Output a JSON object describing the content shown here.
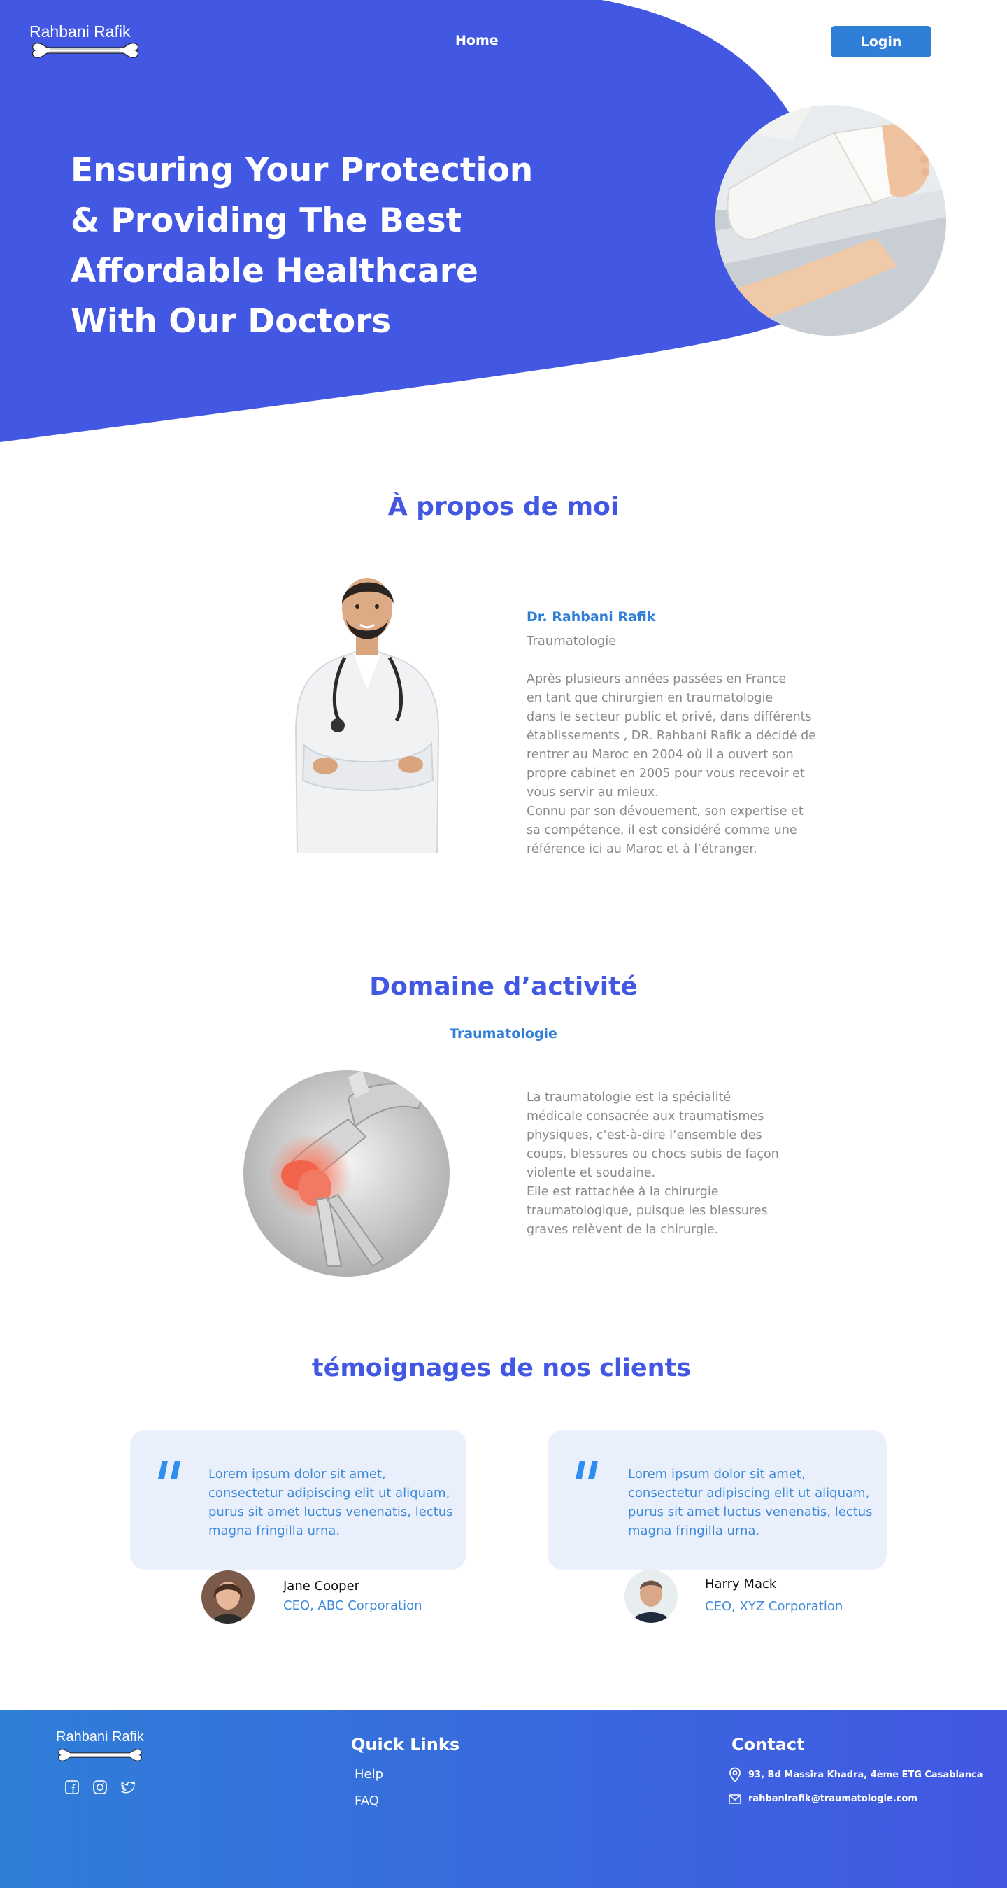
{
  "brand": {
    "name": "Rahbani Rafik"
  },
  "nav": {
    "home": "Home",
    "login": "Login"
  },
  "hero": {
    "title_lines": [
      "Ensuring Your Protection",
      "& Providing The Best",
      "Affordable Healthcare",
      "With Our Doctors"
    ]
  },
  "about": {
    "title": "À propos de moi",
    "name": "Dr. Rahbani Rafik",
    "specialty": "Traumatologie",
    "bio": "Après  plusieurs  années passées en France\nen  tant  que  chirurgien en  traumatologie\ndans le secteur public et privé,  dans différents\nétablissements , DR. Rahbani Rafik a décidé de\nrentrer au Maroc en 2004 où il a ouvert son\npropre cabinet en 2005 pour vous recevoir et\nvous servir au mieux.\nConnu par son dévouement, son expertise et\nsa compétence, il est considéré comme une\nréférence ici au Maroc  et à l’étranger."
  },
  "domain": {
    "title": "Domaine d’activité",
    "subtitle": "Traumatologie",
    "text": " La traumatologie est la spécialité\nmédicale consacrée aux traumatismes\nphysiques, c’est-à-dire l’ensemble des\ncoups, blessures ou chocs subis de façon\nviolente et soudaine.\n Elle  est rattachée à la chirurgie\ntraumatologique, puisque les blessures\ngraves relèvent de la chirurgie."
  },
  "testimonials": {
    "title": "témoignages de nos clients",
    "items": [
      {
        "quote": "Lorem ipsum dolor sit amet, consectetur adipiscing elit ut aliquam, purus sit amet luctus venenatis, lectus magna fringilla urna.",
        "name": "Jane Cooper",
        "role": "CEO, ABC Corporation"
      },
      {
        "quote": "Lorem ipsum dolor sit amet, consectetur adipiscing elit ut aliquam, purus sit amet luctus venenatis, lectus magna fringilla urna.",
        "name": "Harry Mack",
        "role": "CEO, XYZ Corporation"
      }
    ]
  },
  "footer": {
    "quick_links_title": "Quick Links",
    "links": [
      "Help",
      "FAQ"
    ],
    "contact_title": "Contact",
    "address": "93, Bd Massira Khadra, 4ème ETG Casablanca",
    "email": "rahbanirafik@traumatologie.com",
    "socials": [
      "facebook-icon",
      "instagram-icon",
      "twitter-icon"
    ]
  },
  "colors": {
    "primary": "#4257e2",
    "accent": "#2f7ed8",
    "card_bg": "#eaeffc",
    "muted_text": "#8a8a8a"
  }
}
